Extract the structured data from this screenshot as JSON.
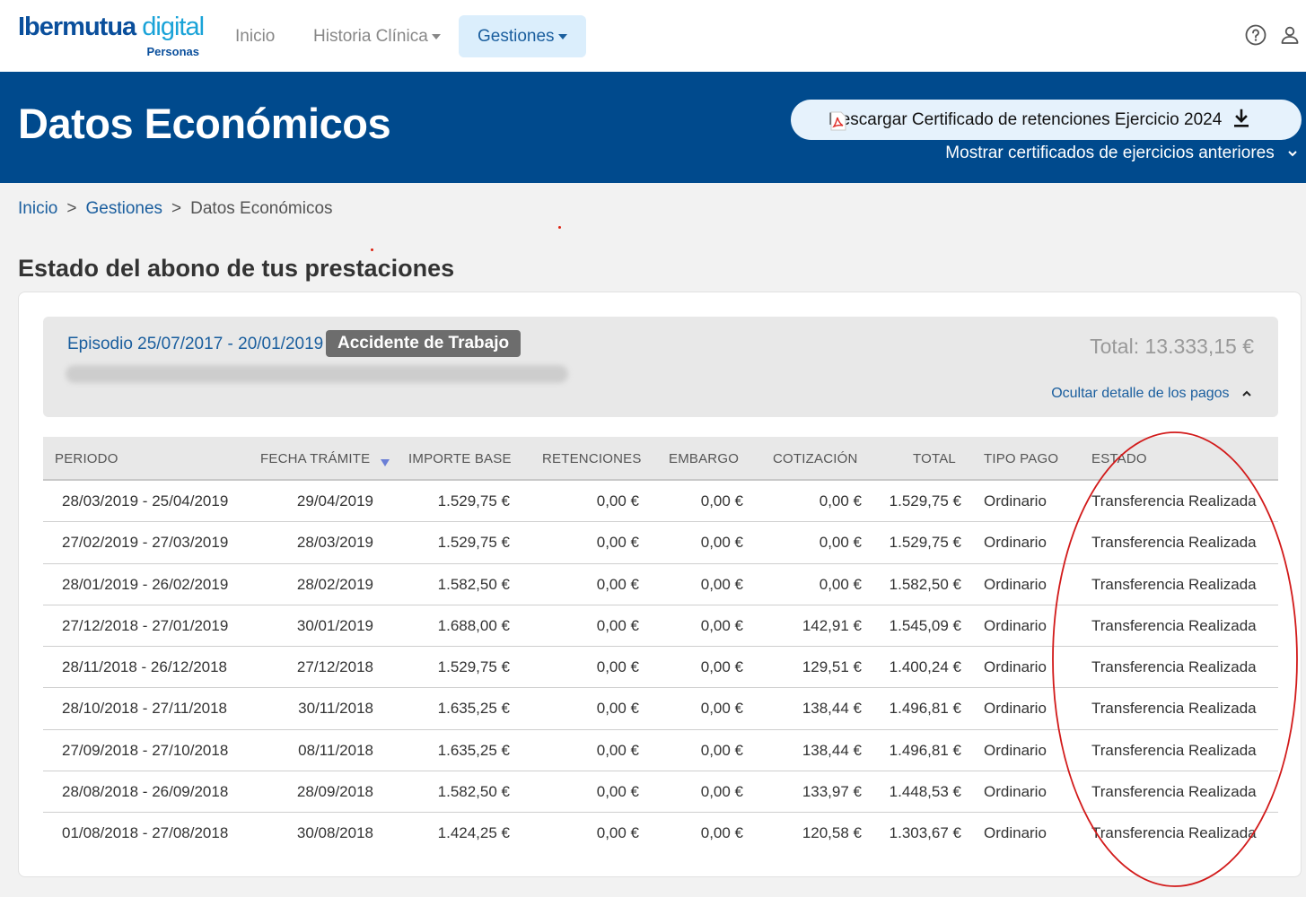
{
  "nav": {
    "logo_main_a": "Ibermutua",
    "logo_main_b": "digital",
    "logo_sub": "Personas",
    "items": [
      {
        "label": "Inicio"
      },
      {
        "label": "Historia Clínica"
      },
      {
        "label": "Gestiones"
      }
    ]
  },
  "banner": {
    "title": "Datos Económicos",
    "cert_button": "Descargar Certificado de retenciones Ejercicio 2024",
    "prev_link": "Mostrar certificados de ejercicios anteriores"
  },
  "breadcrumb": [
    "Inicio",
    "Gestiones",
    "Datos Económicos"
  ],
  "section_title": "Estado del abono de tus prestaciones",
  "episode": {
    "label": "Episodio 25/07/2017 - 20/01/2019",
    "badge": "Accidente de Trabajo",
    "total": "Total: 13.333,15 €",
    "toggle": "Ocultar detalle de los pagos"
  },
  "table": {
    "headers": [
      "PERIODO",
      "FECHA TRÁMITE",
      "IMPORTE BASE",
      "RETENCIONES",
      "EMBARGO",
      "COTIZACIÓN",
      "TOTAL",
      "TIPO PAGO",
      "ESTADO"
    ],
    "rows": [
      [
        "28/03/2019 - 25/04/2019",
        "29/04/2019",
        "1.529,75 €",
        "0,00 €",
        "0,00 €",
        "0,00 €",
        "1.529,75 €",
        "Ordinario",
        "Transferencia Realizada"
      ],
      [
        "27/02/2019 - 27/03/2019",
        "28/03/2019",
        "1.529,75 €",
        "0,00 €",
        "0,00 €",
        "0,00 €",
        "1.529,75 €",
        "Ordinario",
        "Transferencia Realizada"
      ],
      [
        "28/01/2019 - 26/02/2019",
        "28/02/2019",
        "1.582,50 €",
        "0,00 €",
        "0,00 €",
        "0,00 €",
        "1.582,50 €",
        "Ordinario",
        "Transferencia Realizada"
      ],
      [
        "27/12/2018 - 27/01/2019",
        "30/01/2019",
        "1.688,00 €",
        "0,00 €",
        "0,00 €",
        "142,91 €",
        "1.545,09 €",
        "Ordinario",
        "Transferencia Realizada"
      ],
      [
        "28/11/2018 - 26/12/2018",
        "27/12/2018",
        "1.529,75 €",
        "0,00 €",
        "0,00 €",
        "129,51 €",
        "1.400,24 €",
        "Ordinario",
        "Transferencia Realizada"
      ],
      [
        "28/10/2018 - 27/11/2018",
        "30/11/2018",
        "1.635,25 €",
        "0,00 €",
        "0,00 €",
        "138,44 €",
        "1.496,81 €",
        "Ordinario",
        "Transferencia Realizada"
      ],
      [
        "27/09/2018 - 27/10/2018",
        "08/11/2018",
        "1.635,25 €",
        "0,00 €",
        "0,00 €",
        "138,44 €",
        "1.496,81 €",
        "Ordinario",
        "Transferencia Realizada"
      ],
      [
        "28/08/2018 - 26/09/2018",
        "28/09/2018",
        "1.582,50 €",
        "0,00 €",
        "0,00 €",
        "133,97 €",
        "1.448,53 €",
        "Ordinario",
        "Transferencia Realizada"
      ],
      [
        "01/08/2018 - 27/08/2018",
        "30/08/2018",
        "1.424,25 €",
        "0,00 €",
        "0,00 €",
        "120,58 €",
        "1.303,67 €",
        "Ordinario",
        "Transferencia Realizada"
      ]
    ]
  },
  "icons": {
    "help": "help-circle-icon",
    "user": "user-icon",
    "pdf": "pdf-file-icon",
    "download": "download-icon",
    "chevron_down": "chevron-down-icon",
    "chevron_up": "chevron-up-icon",
    "sort": "sort-desc-icon"
  },
  "colors": {
    "brand": "#004a8d",
    "link": "#1a5e9e",
    "active_nav_bg": "#dbeefc",
    "annotation": "#d21a1a"
  }
}
